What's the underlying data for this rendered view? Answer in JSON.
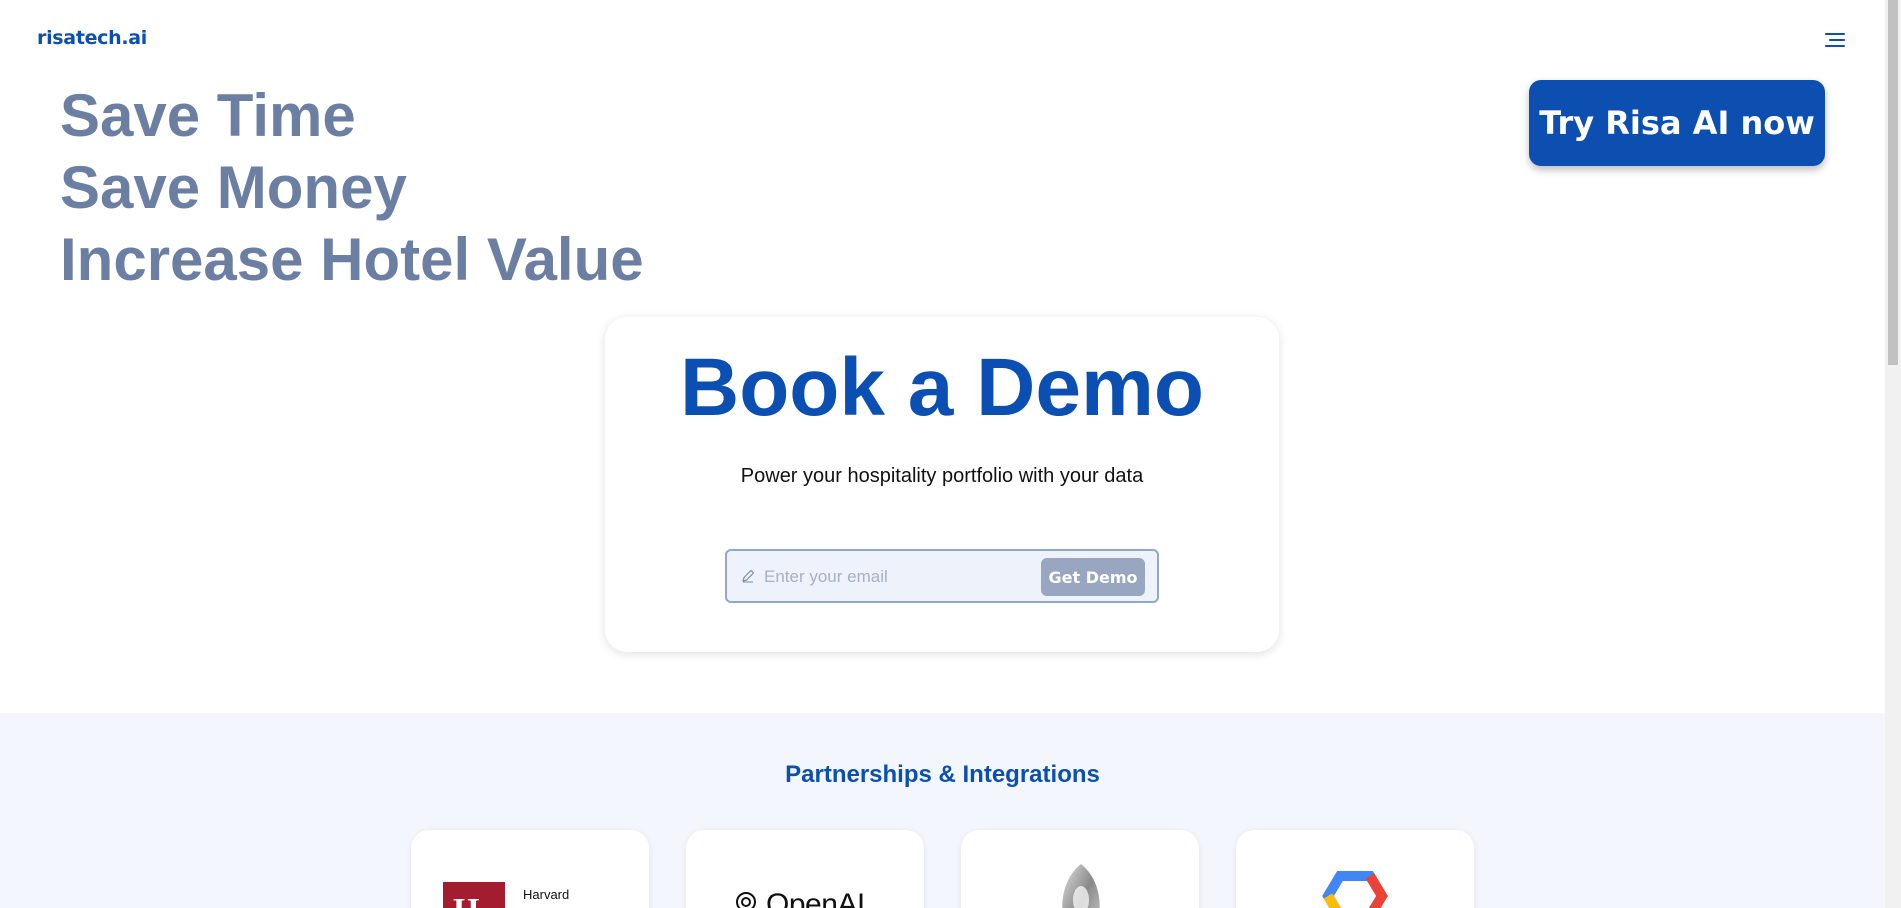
{
  "header": {
    "logo_text": "risatech.ai",
    "menu_icon": "hamburger-menu-icon"
  },
  "hero": {
    "lines": [
      "Save Time",
      "Save Money",
      "Increase Hotel Value"
    ],
    "cta_label": "Try Risa AI now"
  },
  "demo": {
    "title": "Book a Demo",
    "subtitle": "Power your hospitality portfolio with your data",
    "email_placeholder": "Enter your email",
    "email_value": "",
    "submit_label": "Get Demo",
    "input_icon": "pencil-icon"
  },
  "partners": {
    "title": "Partnerships & Integrations",
    "items": [
      {
        "name": "Harvard",
        "logo": "harvard-shield-logo"
      },
      {
        "name": "OpenAI",
        "logo": "openai-logo"
      },
      {
        "name": "",
        "logo": "silver-3d-logo"
      },
      {
        "name": "",
        "logo": "google-cloud-logo"
      }
    ]
  },
  "colors": {
    "brand_blue": "#0b4fb3",
    "hero_text": "#6b7fa3",
    "button_disabled": "#98a6c2",
    "section_bg": "#f3f6fc"
  }
}
